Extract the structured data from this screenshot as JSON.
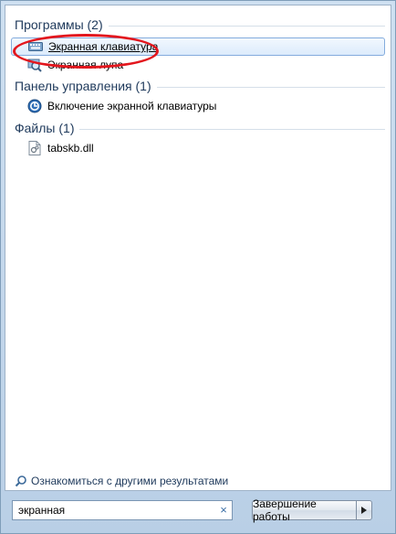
{
  "groups": [
    {
      "header": "Программы (2)",
      "items": [
        {
          "label": "Экранная клавиатура",
          "icon": "keyboard-icon",
          "selected": true
        },
        {
          "label": "Экранная лупа",
          "icon": "magnifier-app-icon",
          "selected": false
        }
      ]
    },
    {
      "header": "Панель управления (1)",
      "items": [
        {
          "label": "Включение экранной клавиатуры",
          "icon": "ease-of-access-icon",
          "selected": false
        }
      ]
    },
    {
      "header": "Файлы (1)",
      "items": [
        {
          "label": "tabskb.dll",
          "icon": "dll-file-icon",
          "selected": false
        }
      ]
    }
  ],
  "see_more": "Ознакомиться с другими результатами",
  "search": {
    "value": "экранная",
    "clear_glyph": "×"
  },
  "shutdown": {
    "label": "Завершение работы",
    "arrow_glyph": "▶"
  },
  "colors": {
    "highlight_oval": "#e3161d",
    "header_text": "#1e395b",
    "selection_border": "#84acdd"
  }
}
